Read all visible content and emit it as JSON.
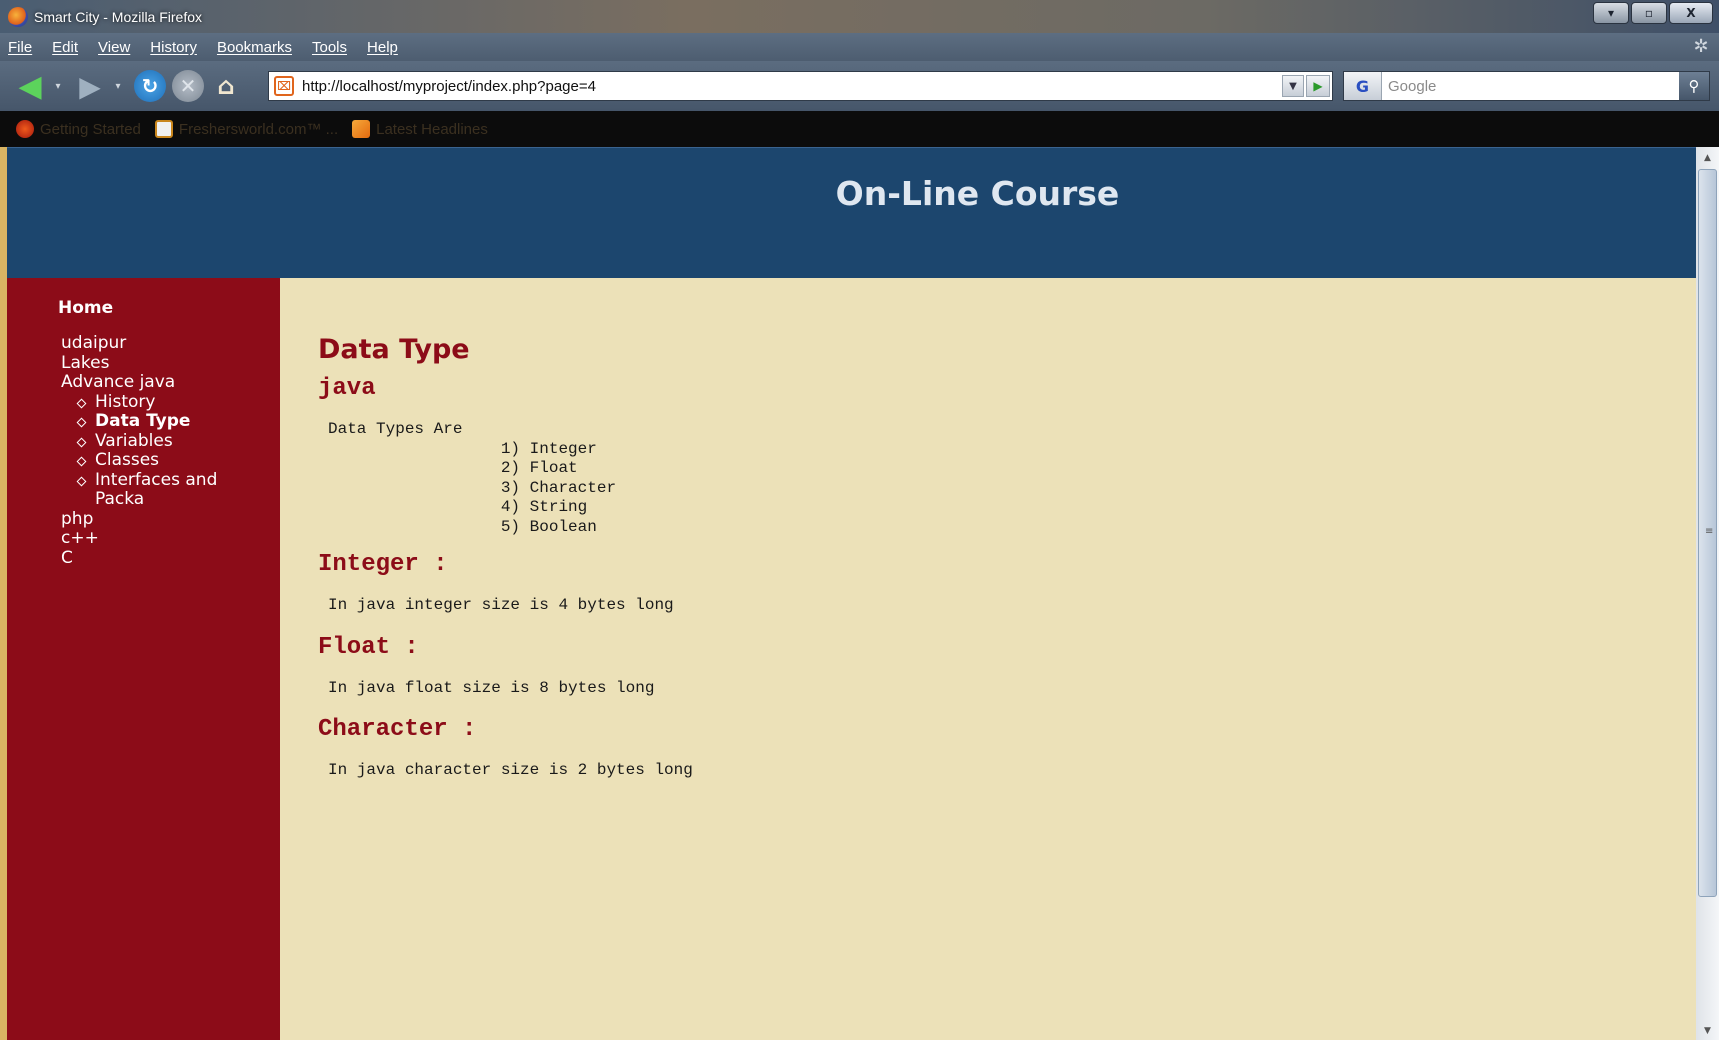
{
  "window": {
    "title": "Smart City - Mozilla Firefox",
    "controls": {
      "minimize": "▾",
      "maximize": "▫",
      "close": "X"
    }
  },
  "menu": [
    "File",
    "Edit",
    "View",
    "History",
    "Bookmarks",
    "Tools",
    "Help"
  ],
  "navbar": {
    "back": "◀",
    "forward": "▶",
    "dropdown": "▾",
    "reload": "↻",
    "stop": "✕",
    "home": "⌂",
    "url": "http://localhost/myproject/index.php?page=4",
    "url_favicon": "⌧",
    "url_dropdown": "▼",
    "go": "▶",
    "search_engine": "G",
    "search_placeholder": "Google",
    "search_icon": "⚲"
  },
  "bookmarks": [
    "Getting Started",
    "Freshersworld.com™ ...",
    "Latest Headlines"
  ],
  "site": {
    "title": "On-Line Course"
  },
  "sidebar": {
    "home": "Home",
    "items": [
      "udaipur",
      "Lakes",
      "Advance java"
    ],
    "sub_items": [
      "History",
      "Data Type",
      "Variables",
      "Classes",
      "Interfaces and Packa"
    ],
    "items_after": [
      "php",
      "c++",
      "C"
    ]
  },
  "content": {
    "page_heading": "Data Type",
    "subheading": "java",
    "intro_pre": "Data Types Are\n                  1) Integer\n                  2) Float\n                  3) Character\n                  4) String\n                  5) Boolean",
    "sections": [
      {
        "heading": "Integer :",
        "text": "In java integer size is 4 bytes long"
      },
      {
        "heading": "Float :",
        "text": "In java float size is 8 bytes long"
      },
      {
        "heading": "Character :",
        "text": "In java character size is 2 bytes long"
      }
    ]
  },
  "scrollbar": {
    "up": "▲",
    "down": "▼",
    "grip": "≡"
  }
}
